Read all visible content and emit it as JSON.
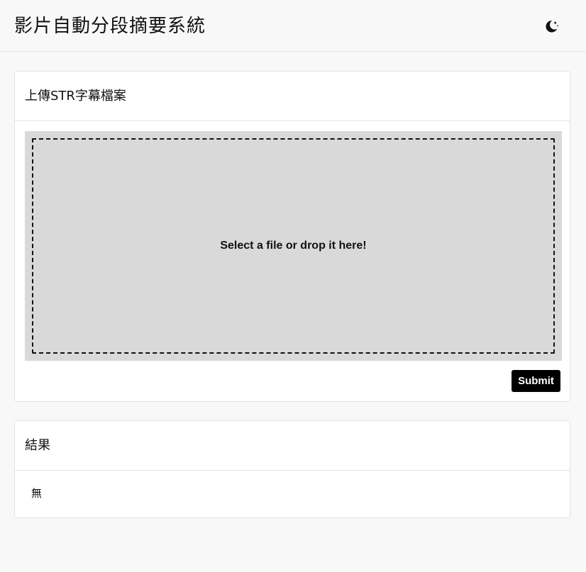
{
  "header": {
    "title": "影片自動分段摘要系統",
    "theme_toggle_icon": "moon-stars-icon"
  },
  "upload_card": {
    "title": "上傳STR字幕檔案",
    "dropzone_text": "Select a file or drop it here!",
    "submit_label": "Submit"
  },
  "result_card": {
    "title": "結果",
    "content": "無"
  },
  "colors": {
    "page_background": "#f8f8f8",
    "card_background": "#ffffff",
    "dropzone_background": "#d9d9d9",
    "button_background": "#000000",
    "button_text": "#ffffff"
  }
}
